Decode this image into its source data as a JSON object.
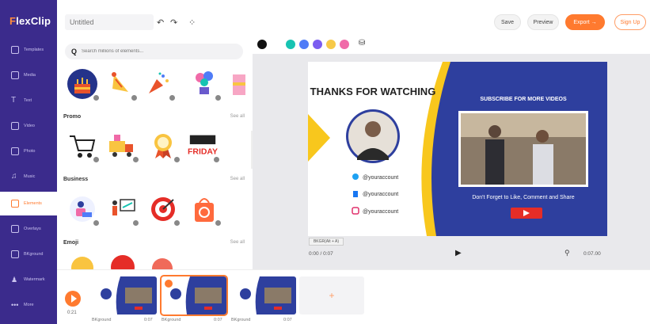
{
  "app": {
    "logo": "FlexClip"
  },
  "sidebar": {
    "items": [
      {
        "label": "Templates"
      },
      {
        "label": "Media"
      },
      {
        "label": "Text"
      },
      {
        "label": "Video"
      },
      {
        "label": "Photo"
      },
      {
        "label": "Music"
      },
      {
        "label": "Elements"
      },
      {
        "label": "Overlays"
      },
      {
        "label": "BKground"
      },
      {
        "label": "Watermark"
      },
      {
        "label": "More"
      }
    ]
  },
  "topbar": {
    "project_placeholder": "Untitled",
    "save_label": "Save",
    "preview_label": "Preview",
    "export_label": "Export →",
    "signup_label": "Sign Up"
  },
  "panel": {
    "search_placeholder": "Search millions of elements...",
    "sections": [
      {
        "title": "Promo",
        "see_all": "See all"
      },
      {
        "title": "Business",
        "see_all": "See all"
      },
      {
        "title": "Emoji",
        "see_all": "See all"
      }
    ],
    "friday_text": "FRIDAY"
  },
  "colorbar": {
    "swatches": [
      "#111111",
      "#17c3b2",
      "#4f7cf7",
      "#7b5cf0",
      "#f7c948",
      "#f06aa8"
    ]
  },
  "slide": {
    "title": "THANKS FOR WATCHING",
    "subscribe": "SUBSCRIBE FOR MORE VIDEOS",
    "cta": "Don't Forget to Like, Comment and Share",
    "social": [
      {
        "handle": "@youraccount"
      },
      {
        "handle": "@youraccount"
      },
      {
        "handle": "@youraccount"
      }
    ],
    "colors": {
      "blue": "#2e3f9e",
      "yellow": "#f8c71d",
      "red": "#e52d27"
    }
  },
  "player": {
    "tag": "BKGR(Alt + A)",
    "time_left": "0:00 / 0:07",
    "time_right": "0:07.00"
  },
  "timeline": {
    "total": "0:21",
    "clips": [
      {
        "label": "BKground",
        "duration": "0:07"
      },
      {
        "label": "BKground",
        "duration": "0:07"
      },
      {
        "label": "BKground",
        "duration": "0:07"
      }
    ],
    "add_label": "+"
  }
}
